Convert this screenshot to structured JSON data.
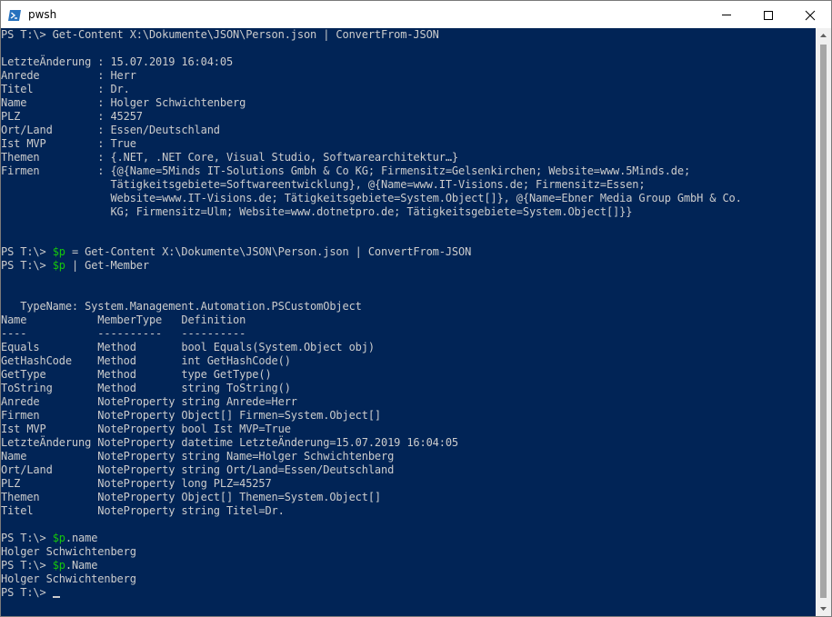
{
  "window": {
    "title": "pwsh",
    "icon": "powershell-icon",
    "controls": [
      "minimize-icon",
      "maximize-icon",
      "close-icon"
    ]
  },
  "colors": {
    "console_bg": "#012456",
    "console_fg": "#cccccc",
    "variable": "#16c60c"
  },
  "console": {
    "cmd1": "PS T:\\> Get-Content X:\\Dokumente\\JSON\\Person.json | ConvertFrom-JSON",
    "props": [
      "LetzteÄnderung : 15.07.2019 16:04:05",
      "Anrede         : Herr",
      "Titel          : Dr.",
      "Name           : Holger Schwichtenberg",
      "PLZ            : 45257",
      "Ort/Land       : Essen/Deutschland",
      "Ist MVP        : True",
      "Themen         : {.NET, .NET Core, Visual Studio, Softwarearchitektur…}",
      "Firmen         : {@{Name=5Minds IT-Solutions Gmbh & Co KG; Firmensitz=Gelsenkirchen; Website=www.5Minds.de;",
      "                 Tätigkeitsgebiete=Softwareentwicklung}, @{Name=www.IT-Visions.de; Firmensitz=Essen;",
      "                 Website=www.IT-Visions.de; Tätigkeitsgebiete=System.Object[]}, @{Name=Ebner Media Group GmbH & Co.",
      "                 KG; Firmensitz=Ulm; Website=www.dotnetpro.de; Tätigkeitsgebiete=System.Object[]}}"
    ],
    "cmd2": {
      "prompt": "PS T:\\> ",
      "var": "$p",
      "rest": " = Get-Content X:\\Dokumente\\JSON\\Person.json | ConvertFrom-JSON"
    },
    "cmd3": {
      "prompt": "PS T:\\> ",
      "var": "$p",
      "rest": " | Get-Member"
    },
    "gm_typename": "   TypeName: System.Management.Automation.PSCustomObject",
    "gm_table": [
      "Name           MemberType   Definition",
      "----           ----------   ----------",
      "Equals         Method       bool Equals(System.Object obj)",
      "GetHashCode    Method       int GetHashCode()",
      "GetType        Method       type GetType()",
      "ToString       Method       string ToString()",
      "Anrede         NoteProperty string Anrede=Herr",
      "Firmen         NoteProperty Object[] Firmen=System.Object[]",
      "Ist MVP        NoteProperty bool Ist MVP=True",
      "LetzteÄnderung NoteProperty datetime LetzteÄnderung=15.07.2019 16:04:05",
      "Name           NoteProperty string Name=Holger Schwichtenberg",
      "Ort/Land       NoteProperty string Ort/Land=Essen/Deutschland",
      "PLZ            NoteProperty long PLZ=45257",
      "Themen         NoteProperty Object[] Themen=System.Object[]",
      "Titel          NoteProperty string Titel=Dr."
    ],
    "cmd4": {
      "prompt": "PS T:\\> ",
      "var": "$p",
      "rest": ".name"
    },
    "out4": "Holger Schwichtenberg",
    "cmd5": {
      "prompt": "PS T:\\> ",
      "var": "$p",
      "rest": ".Name"
    },
    "out5": "Holger Schwichtenberg",
    "final_prompt": "PS T:\\> "
  }
}
